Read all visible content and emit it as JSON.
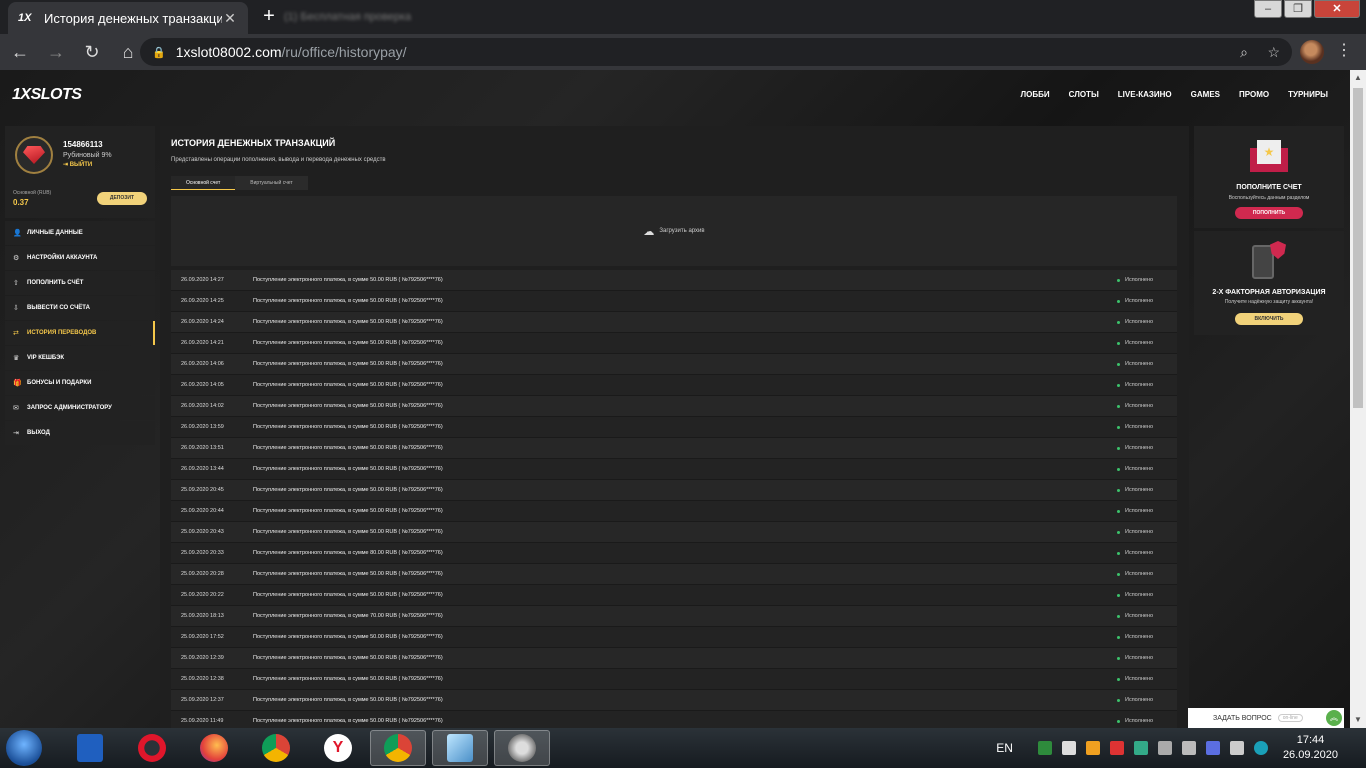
{
  "browser": {
    "tab_title": "История денежных транзакций",
    "tab_favicon": "1X",
    "tab_close": "✕",
    "new_tab": "+",
    "other_tab_title": "(1) Бесплатная проверка",
    "url_host": "1xslot08002.com",
    "url_path": "/ru/office/historypay/",
    "window_buttons": [
      "–",
      "❐",
      "✕"
    ]
  },
  "site": {
    "logo_prefix": "1X",
    "logo_suffix": "SLOTS",
    "nav": [
      "ЛОББИ",
      "СЛОТЫ",
      "LIVE-КАЗИНО",
      "GAMES",
      "ПРОМО",
      "ТУРНИРЫ"
    ]
  },
  "profile": {
    "user_id": "154866113",
    "rank": "Рубиновый 9%",
    "logout": "ВЫЙТИ",
    "account_label": "Основной (RUB)",
    "balance": "0.37",
    "deposit": "ДЕПОЗИТ"
  },
  "sidebar": {
    "items": [
      {
        "label": "ЛИЧНЫЕ ДАННЫЕ",
        "icon": "user-icon",
        "glyph": "👤"
      },
      {
        "label": "НАСТРОЙКИ АККАУНТА",
        "icon": "gear-icon",
        "glyph": "⚙"
      },
      {
        "label": "ПОПОЛНИТЬ СЧЁТ",
        "icon": "upload-icon",
        "glyph": "⇧"
      },
      {
        "label": "ВЫВЕСТИ СО СЧЁТА",
        "icon": "download-icon",
        "glyph": "⇩"
      },
      {
        "label": "ИСТОРИЯ ПЕРЕВОДОВ",
        "icon": "transfer-icon",
        "glyph": "⇄",
        "active": true
      },
      {
        "label": "VIP КЕШБЭК",
        "icon": "crown-icon",
        "glyph": "♛"
      },
      {
        "label": "БОНУСЫ И ПОДАРКИ",
        "icon": "gift-icon",
        "glyph": "🎁"
      },
      {
        "label": "ЗАПРОС АДМИНИСТРАТОРУ",
        "icon": "mail-icon",
        "glyph": "✉"
      },
      {
        "label": "ВЫХОД",
        "icon": "exit-icon",
        "glyph": "⇥"
      }
    ]
  },
  "main": {
    "title": "ИСТОРИЯ ДЕНЕЖНЫХ ТРАНЗАКЦИЙ",
    "description": "Представлены операции пополнения, вывода и перевода денежных средств",
    "tabs": [
      "Основной счет",
      "Виртуальный счет"
    ],
    "archive_label": "Загрузить архив",
    "transactions": [
      {
        "date": "26.09.2020 14:27",
        "desc": "Поступление электронного платежа, в сумме 50.00 RUB ( №792506****76)",
        "status": "Исполнено"
      },
      {
        "date": "26.09.2020 14:25",
        "desc": "Поступление электронного платежа, в сумме 50.00 RUB ( №792506****76)",
        "status": "Исполнено"
      },
      {
        "date": "26.09.2020 14:24",
        "desc": "Поступление электронного платежа, в сумме 50.00 RUB ( №792506****76)",
        "status": "Исполнено"
      },
      {
        "date": "26.09.2020 14:21",
        "desc": "Поступление электронного платежа, в сумме 50.00 RUB ( №792506****76)",
        "status": "Исполнено"
      },
      {
        "date": "26.09.2020 14:06",
        "desc": "Поступление электронного платежа, в сумме 50.00 RUB ( №792506****76)",
        "status": "Исполнено"
      },
      {
        "date": "26.09.2020 14:05",
        "desc": "Поступление электронного платежа, в сумме 50.00 RUB ( №792506****76)",
        "status": "Исполнено"
      },
      {
        "date": "26.09.2020 14:02",
        "desc": "Поступление электронного платежа, в сумме 50.00 RUB ( №792506****76)",
        "status": "Исполнено"
      },
      {
        "date": "26.09.2020 13:59",
        "desc": "Поступление электронного платежа, в сумме 50.00 RUB ( №792506****76)",
        "status": "Исполнено"
      },
      {
        "date": "26.09.2020 13:51",
        "desc": "Поступление электронного платежа, в сумме 50.00 RUB ( №792506****76)",
        "status": "Исполнено"
      },
      {
        "date": "26.09.2020 13:44",
        "desc": "Поступление электронного платежа, в сумме 50.00 RUB ( №792506****76)",
        "status": "Исполнено"
      },
      {
        "date": "25.09.2020 20:45",
        "desc": "Поступление электронного платежа, в сумме 50.00 RUB ( №792506****76)",
        "status": "Исполнено"
      },
      {
        "date": "25.09.2020 20:44",
        "desc": "Поступление электронного платежа, в сумме 50.00 RUB ( №792506****76)",
        "status": "Исполнено"
      },
      {
        "date": "25.09.2020 20:43",
        "desc": "Поступление электронного платежа, в сумме 50.00 RUB ( №792506****76)",
        "status": "Исполнено"
      },
      {
        "date": "25.09.2020 20:33",
        "desc": "Поступление электронного платежа, в сумме 80.00 RUB ( №792506****76)",
        "status": "Исполнено"
      },
      {
        "date": "25.09.2020 20:28",
        "desc": "Поступление электронного платежа, в сумме 50.00 RUB ( №792506****76)",
        "status": "Исполнено"
      },
      {
        "date": "25.09.2020 20:22",
        "desc": "Поступление электронного платежа, в сумме 50.00 RUB ( №792506****76)",
        "status": "Исполнено"
      },
      {
        "date": "25.09.2020 18:13",
        "desc": "Поступление электронного платежа, в сумме 70.00 RUB ( №792506****76)",
        "status": "Исполнено"
      },
      {
        "date": "25.09.2020 17:52",
        "desc": "Поступление электронного платежа, в сумме 50.00 RUB ( №792506****76)",
        "status": "Исполнено"
      },
      {
        "date": "25.09.2020 12:39",
        "desc": "Поступление электронного платежа, в сумме 50.00 RUB ( №792506****76)",
        "status": "Исполнено"
      },
      {
        "date": "25.09.2020 12:38",
        "desc": "Поступление электронного платежа, в сумме 50.00 RUB ( №792506****76)",
        "status": "Исполнено"
      },
      {
        "date": "25.09.2020 12:37",
        "desc": "Поступление электронного платежа, в сумме 50.00 RUB ( №792506****76)",
        "status": "Исполнено"
      },
      {
        "date": "25.09.2020 11:49",
        "desc": "Поступление электронного платежа, в сумме 50.00 RUB ( №792506****76)",
        "status": "Исполнено"
      }
    ]
  },
  "promos": {
    "topup": {
      "title": "ПОПОЛНИТЕ СЧЕТ",
      "subtitle": "Воспользуйтесь данным разделом",
      "button": "ПОПОЛНИТЬ"
    },
    "twofa": {
      "title": "2-Х ФАКТОРНАЯ АВТОРИЗАЦИЯ",
      "subtitle": "Получите надёжную защиту аккаунта!",
      "button": "ВКЛЮЧИТЬ"
    }
  },
  "support": {
    "label": "ЗАДАТЬ ВОПРОС",
    "status": "on-line"
  },
  "taskbar": {
    "language": "EN",
    "time": "17:44",
    "date": "26.09.2020"
  },
  "colors": {
    "accent": "#f5c84b",
    "brand_red": "#d0294f",
    "status_green": "#3cc26b"
  }
}
